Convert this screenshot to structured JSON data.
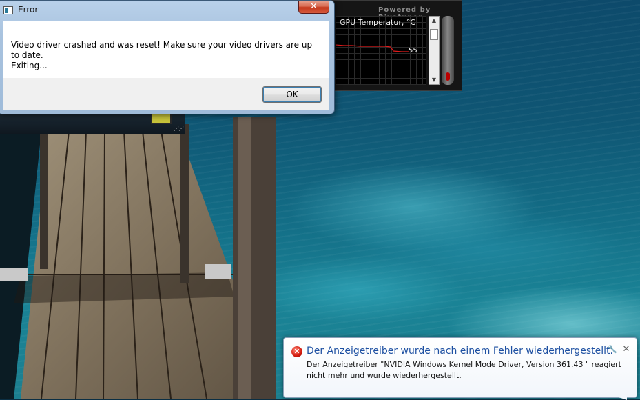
{
  "dialog": {
    "title": "Error",
    "close_label": "✕",
    "message": "Video driver crashed and was reset!  Make sure your video drivers are up to date.\nExiting...",
    "ok_label": "OK"
  },
  "monitor": {
    "powered_by": "Powered by Rivatuner",
    "graph_title": "GPU Temperatur, °C",
    "current_value": "55",
    "line_color": "#e11b1b"
  },
  "notification": {
    "headline": "Der Anzeigetreiber wurde nach einem Fehler wiederhergestellt.",
    "body": "Der Anzeigetreiber \"NVIDIA Windows Kernel Mode Driver, Version 361.43 \" reagiert nicht mehr und wurde wiederhergestellt.",
    "icon": "error-icon",
    "close_label": "✕",
    "options_label": "🔧"
  },
  "wallpaper": {
    "description_colors": {
      "water": "#136d86",
      "wood": "#8a7a62"
    }
  }
}
